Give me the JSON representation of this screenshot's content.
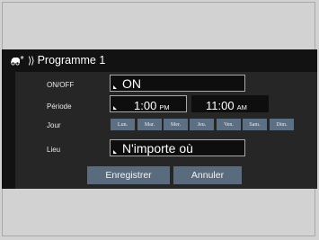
{
  "header": {
    "title": "Programme 1",
    "car_icon": "car-phone-icon",
    "chevron_icon": "double-chevron-icon"
  },
  "rows": {
    "onoff": {
      "label": "ON/OFF",
      "value": "ON"
    },
    "periode": {
      "label": "Période",
      "start_time": "1:00",
      "start_ampm": "PM",
      "end_time": "11:00",
      "end_ampm": "AM"
    },
    "jour": {
      "label": "Jour",
      "days": [
        "Lun.",
        "Mar.",
        "Mer.",
        "Jeu.",
        "Ven.",
        "Sam.",
        "Dim."
      ]
    },
    "lieu": {
      "label": "Lieu",
      "value": "N'importe où"
    }
  },
  "buttons": {
    "save_label": "Enregistrer",
    "cancel_label": "Annuler"
  },
  "colors": {
    "screen_bg": "#121212",
    "panel_bg": "#262626",
    "button_bg": "#5a6b7e",
    "day_bg": "#5d6f82"
  }
}
